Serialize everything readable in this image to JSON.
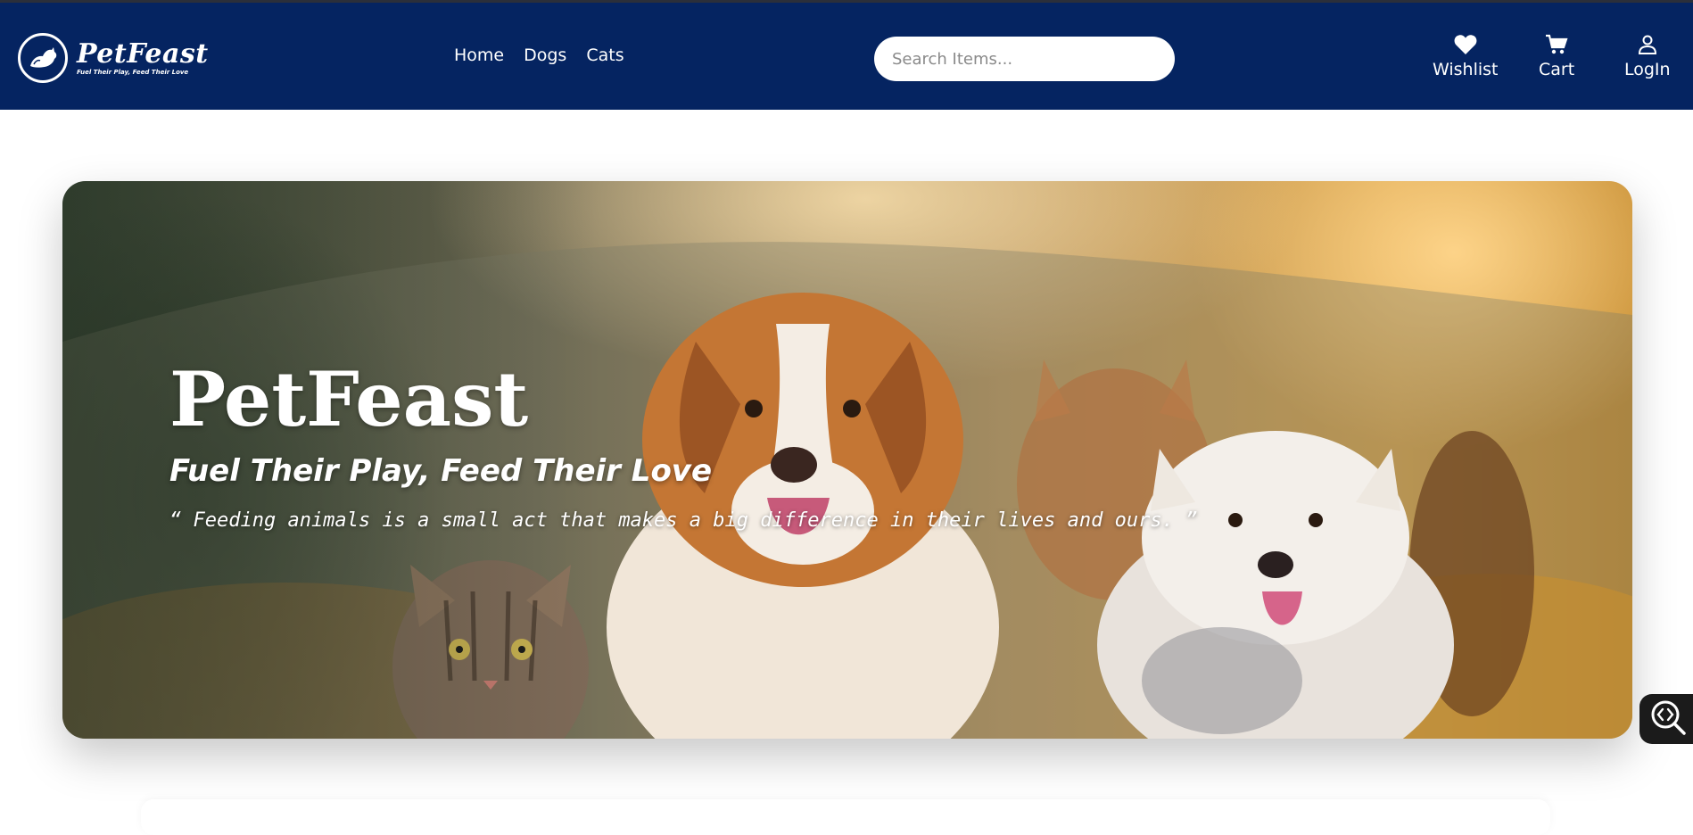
{
  "brand": {
    "name": "PetFeast",
    "tagline": "Fuel Their Play, Feed Their Love",
    "logo_icon": "pet-silhouette-icon",
    "colors": {
      "navbar": "#052461",
      "text": "#ffffff"
    }
  },
  "nav": {
    "links": [
      {
        "label": "Home"
      },
      {
        "label": "Dogs"
      },
      {
        "label": "Cats"
      }
    ]
  },
  "search": {
    "placeholder": "Search Items..."
  },
  "actions": {
    "wishlist": {
      "label": "Wishlist",
      "icon": "heart-icon"
    },
    "cart": {
      "label": "Cart",
      "icon": "cart-icon"
    },
    "login": {
      "label": "LogIn",
      "icon": "user-icon"
    }
  },
  "hero": {
    "title": "PetFeast",
    "subtitle": "Fuel Their Play, Feed Their Love",
    "quote": "“ Feeding animals is a small act that makes a big difference in their lives and ours. ”"
  },
  "widget": {
    "icon": "code-zoom-icon"
  }
}
